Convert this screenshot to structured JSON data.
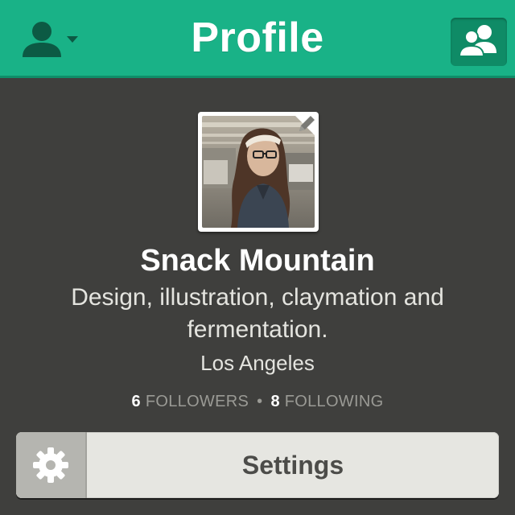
{
  "header": {
    "title": "Profile",
    "account_icon": "user-dropdown-icon",
    "friends_icon": "people-icon",
    "accent_color": "#19b287"
  },
  "profile": {
    "name": "Snack Mountain",
    "bio": "Design, illustration, claymation and fermentation.",
    "location": "Los Angeles",
    "avatar_edit_icon": "pencil-icon"
  },
  "stats": {
    "followers_count": "6",
    "followers_label": "FOLLOWERS",
    "separator": "•",
    "following_count": "8",
    "following_label": "FOLLOWING"
  },
  "settings": {
    "label": "Settings",
    "icon": "gear-icon"
  }
}
